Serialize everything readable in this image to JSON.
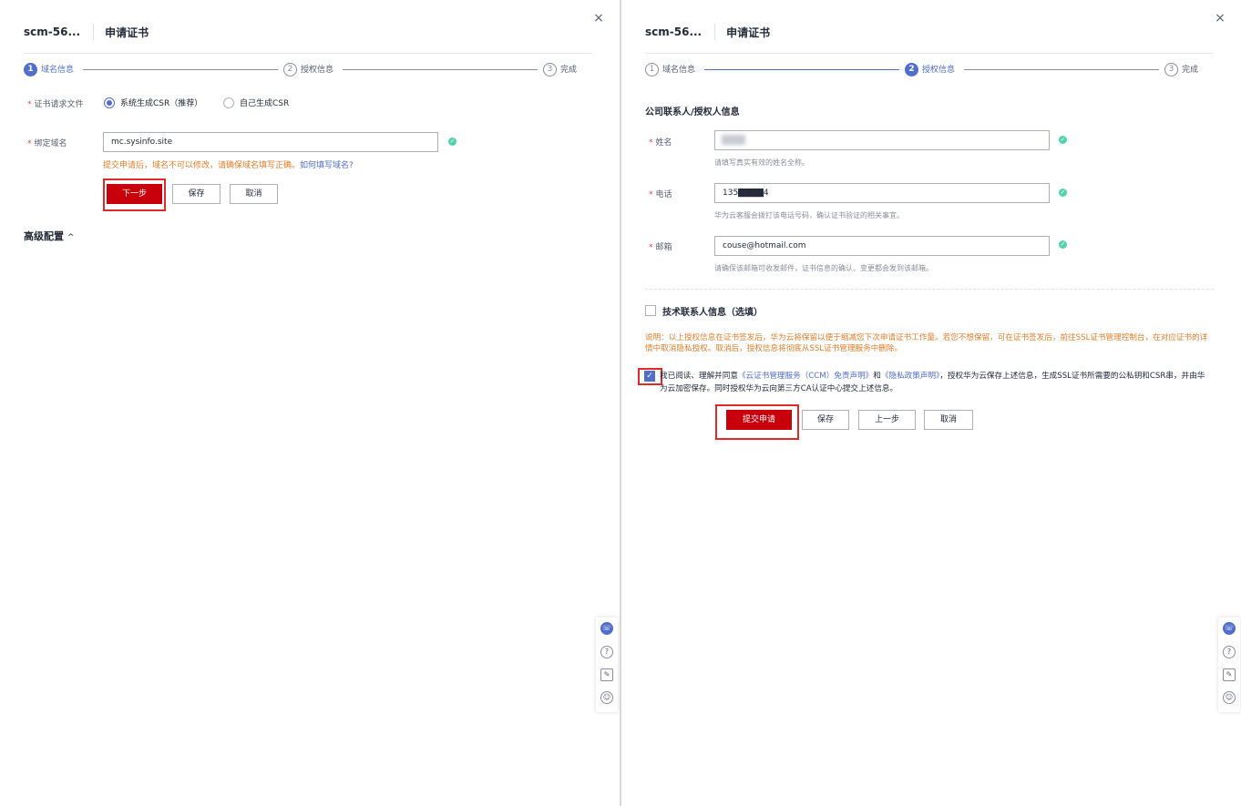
{
  "left": {
    "header": {
      "cert_id": "scm-56...",
      "title": "申请证书"
    },
    "steps": [
      {
        "num": "1",
        "label": "域名信息"
      },
      {
        "num": "2",
        "label": "授权信息"
      },
      {
        "num": "3",
        "label": "完成"
      }
    ],
    "csr": {
      "label": "证书请求文件",
      "options": [
        "系统生成CSR（推荐）",
        "自己生成CSR"
      ],
      "selected": "系统生成CSR（推荐）"
    },
    "domain": {
      "label": "绑定域名",
      "value": "mc.sysinfo.site",
      "warning": "提交申请后，域名不可以修改，请确保域名填写正确。",
      "help_link": "如何填写域名?"
    },
    "buttons": {
      "next": "下一步",
      "save": "保存",
      "cancel": "取消"
    },
    "advanced": {
      "label": "高级配置",
      "caret": "^"
    }
  },
  "right": {
    "header": {
      "cert_id": "scm-56...",
      "title": "申请证书"
    },
    "steps": [
      {
        "num": "1",
        "label": "域名信息"
      },
      {
        "num": "2",
        "label": "授权信息"
      },
      {
        "num": "3",
        "label": "完成"
      }
    ],
    "section_title": "公司联系人/授权人信息",
    "name": {
      "label": "姓名",
      "value": "",
      "hint": "请填写真实有效的姓名全称。"
    },
    "phone": {
      "label": "电话",
      "value": "135████4",
      "hint": "华为云客服会拨打该电话号码，确认证书验证的相关事宜。"
    },
    "email": {
      "label": "邮箱",
      "value": "couse@hotmail.com",
      "hint": "请确保该邮箱可收发邮件，证书信息的确认、变更都会发到该邮箱。"
    },
    "tech_contact": {
      "label": "技术联系人信息（选填）"
    },
    "note": "说明：以上授权信息在证书签发后，华为云将保留以便于缩减您下次申请证书工作量。若您不想保留，可在证书签发后，前往SSL证书管理控制台，在对应证书的详情中取消隐私授权。取消后，授权信息将彻底从SSL证书管理服务中删除。",
    "agreement": {
      "prefix": "我已阅读、理解并同意",
      "link1": "《云证书管理服务（CCM）免责声明》",
      "and": "和",
      "link2": "《隐私政策声明》",
      "suffix": "，授权华为云保存上述信息，生成SSL证书所需要的公私钥和CSR串，并由华为云加密保存。同时授权华为云向第三方CA认证中心提交上述信息。"
    },
    "buttons": {
      "submit": "提交申请",
      "save": "保存",
      "prev": "上一步",
      "cancel": "取消"
    }
  },
  "icons": {
    "close": "×",
    "check": "✓",
    "service": "☏",
    "help": "?",
    "feedback": "✎",
    "smile": "☺"
  }
}
